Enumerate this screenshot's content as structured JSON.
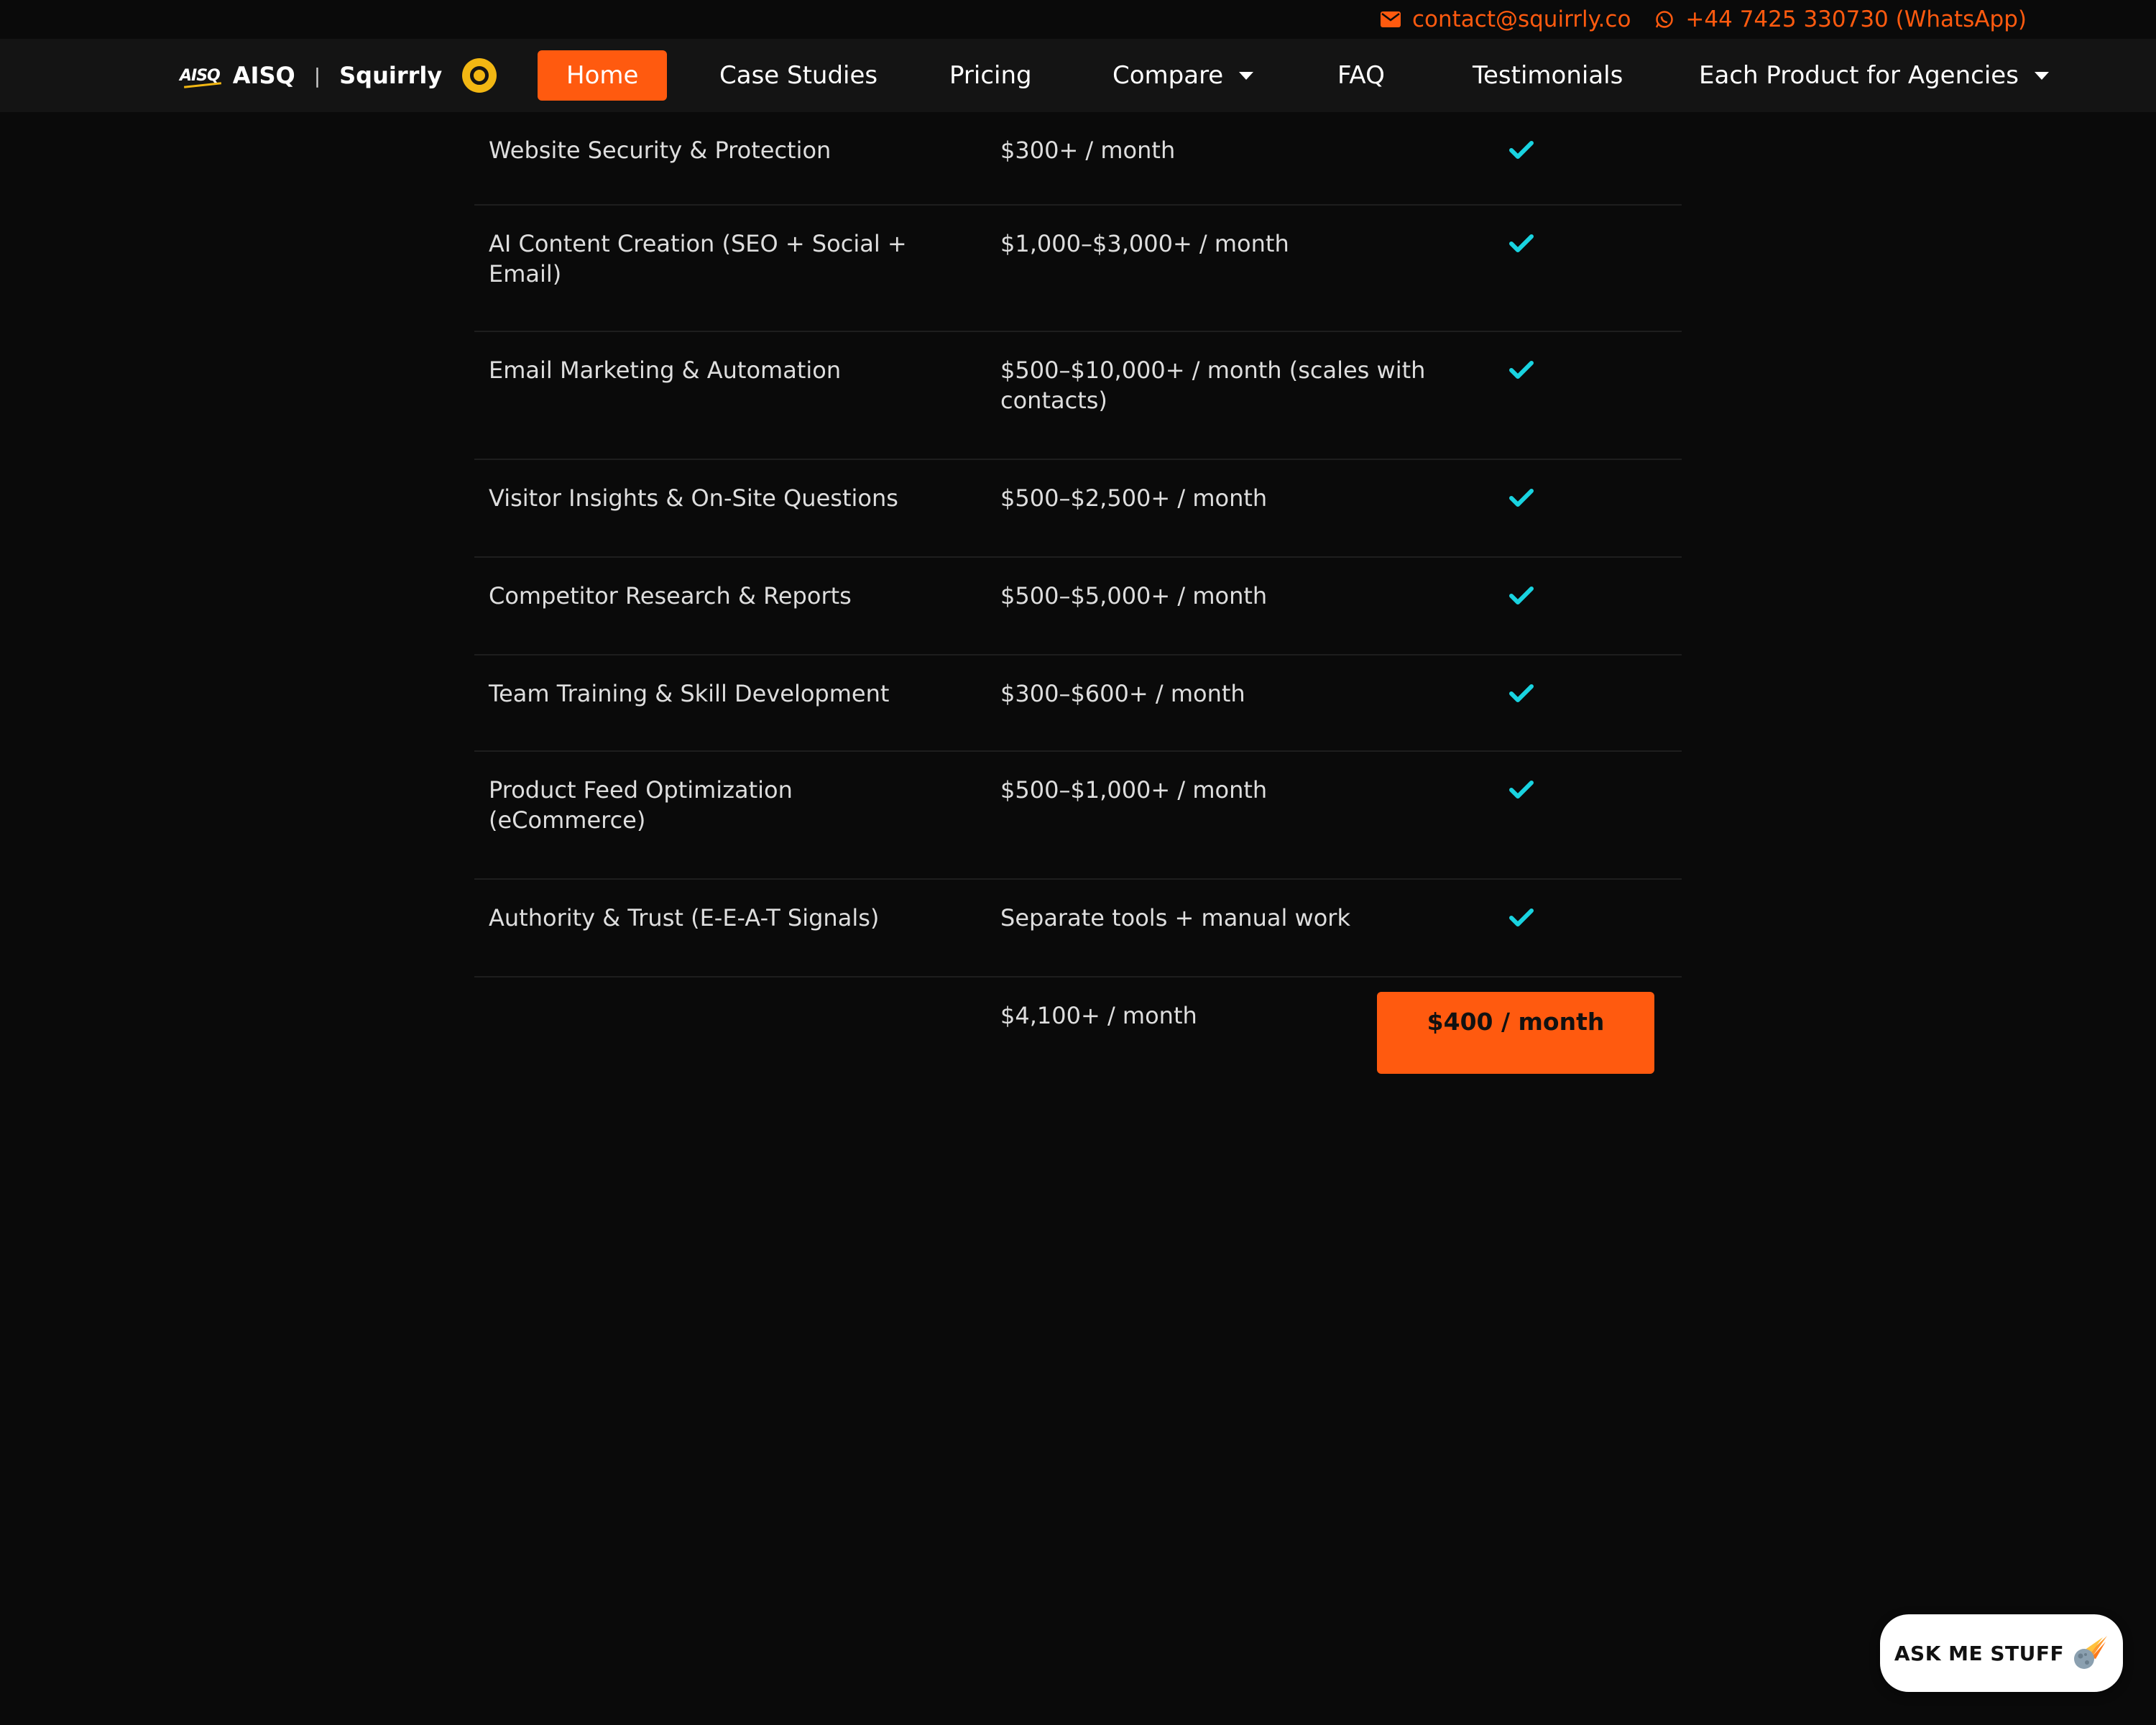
{
  "topbar": {
    "email": "contact@squirrly.co",
    "phone": "+44 7425 330730 (WhatsApp)",
    "icons": [
      "envelope-icon",
      "whatsapp-icon"
    ]
  },
  "brand": {
    "mark": "AISQ",
    "name1": "AISQ",
    "separator": "|",
    "name2": "Squirrly"
  },
  "nav": {
    "items": [
      {
        "label": "Home",
        "active": true
      },
      {
        "label": "Case Studies"
      },
      {
        "label": "Pricing"
      },
      {
        "label": "Compare",
        "dropdown": true
      },
      {
        "label": "FAQ"
      },
      {
        "label": "Testimonials"
      },
      {
        "label": "Each Product for Agencies",
        "dropdown": true
      }
    ]
  },
  "table": {
    "rows": [
      {
        "feature": "Website Security & Protection",
        "cost": "$300+ / month",
        "included": true
      },
      {
        "feature": "AI Content Creation (SEO + Social + Email)",
        "cost": "$1,000–$3,000+ / month",
        "included": true
      },
      {
        "feature": "Email Marketing & Automation",
        "cost": "$500–$10,000+ / month (scales with contacts)",
        "included": true
      },
      {
        "feature": "Visitor Insights & On-Site Questions",
        "cost": "$500–$2,500+ / month",
        "included": true
      },
      {
        "feature": "Competitor Research & Reports",
        "cost": "$500–$5,000+ / month",
        "included": true
      },
      {
        "feature": "Team Training & Skill Development",
        "cost": "$300–$600+ / month",
        "included": true
      },
      {
        "feature": "Product Feed Optimization (eCommerce)",
        "cost": "$500–$1,000+ / month",
        "included": true
      },
      {
        "feature": "Authority & Trust (E-E-A-T Signals)",
        "cost": "Separate tools + manual work",
        "included": true
      }
    ],
    "total": {
      "cost": "$4,100+ / month",
      "price": "$400 / month"
    },
    "check_color": "#19d3e0"
  },
  "chat": {
    "label": "ASK ME STUFF",
    "icon": "meteor-icon"
  },
  "colors": {
    "accent": "#ff5a0f",
    "background": "#0a0a0a",
    "navbar": "#141414",
    "check": "#19d3e0"
  }
}
